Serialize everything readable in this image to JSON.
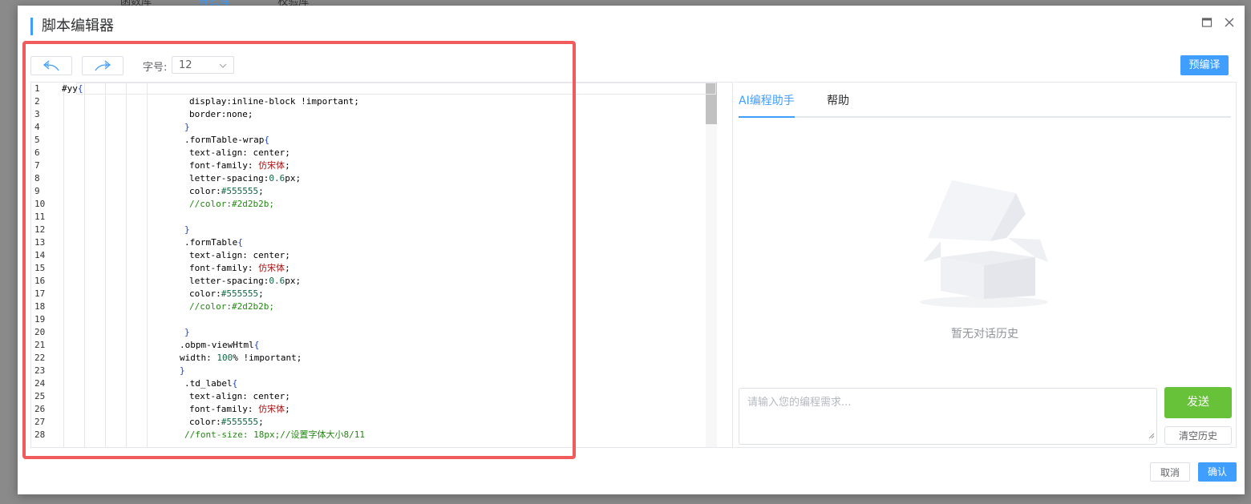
{
  "background_tabs": [
    "函数库",
    "样式库",
    "校验库"
  ],
  "modal": {
    "title": "脚本编辑器",
    "maximize_icon": "maximize-icon",
    "close_icon": "close-icon"
  },
  "toolbar": {
    "undo_icon": "undo-icon",
    "redo_icon": "redo-icon",
    "font_size_label": "字号:",
    "font_size_value": "12",
    "precompile_label": "预编译"
  },
  "editor": {
    "lines": [
      {
        "n": "1",
        "indent": 0,
        "tokens": [
          [
            "t",
            "#yy"
          ],
          [
            "b",
            "{"
          ]
        ]
      },
      {
        "n": "2",
        "indent": 159,
        "tokens": [
          [
            "t",
            "display:inline-block !important;"
          ]
        ]
      },
      {
        "n": "3",
        "indent": 159,
        "tokens": [
          [
            "t",
            "border:none;"
          ]
        ]
      },
      {
        "n": "4",
        "indent": 153,
        "tokens": [
          [
            "b",
            "}"
          ]
        ]
      },
      {
        "n": "5",
        "indent": 153,
        "tokens": [
          [
            "t",
            ".formTable-wrap"
          ],
          [
            "b",
            "{"
          ]
        ]
      },
      {
        "n": "6",
        "indent": 159,
        "tokens": [
          [
            "t",
            "text-align: center;"
          ]
        ]
      },
      {
        "n": "7",
        "indent": 159,
        "tokens": [
          [
            "t",
            "font-family: "
          ],
          [
            "s",
            "仿宋体"
          ],
          [
            "t",
            ";"
          ]
        ]
      },
      {
        "n": "8",
        "indent": 159,
        "tokens": [
          [
            "t",
            "letter-spacing:"
          ],
          [
            "n",
            "0.6"
          ],
          [
            "t",
            "px;"
          ]
        ]
      },
      {
        "n": "9",
        "indent": 159,
        "tokens": [
          [
            "t",
            "color:"
          ],
          [
            "h",
            "#555555"
          ],
          [
            "t",
            ";"
          ]
        ]
      },
      {
        "n": "10",
        "indent": 159,
        "tokens": [
          [
            "c",
            "//color:#2d2b2b;"
          ]
        ]
      },
      {
        "n": "11",
        "indent": 0,
        "tokens": []
      },
      {
        "n": "12",
        "indent": 153,
        "tokens": [
          [
            "b",
            "}"
          ]
        ]
      },
      {
        "n": "13",
        "indent": 153,
        "tokens": [
          [
            "t",
            ".formTable"
          ],
          [
            "b",
            "{"
          ]
        ]
      },
      {
        "n": "14",
        "indent": 159,
        "tokens": [
          [
            "t",
            "text-align: center;"
          ]
        ]
      },
      {
        "n": "15",
        "indent": 159,
        "tokens": [
          [
            "t",
            "font-family: "
          ],
          [
            "s",
            "仿宋体"
          ],
          [
            "t",
            ";"
          ]
        ]
      },
      {
        "n": "16",
        "indent": 159,
        "tokens": [
          [
            "t",
            "letter-spacing:"
          ],
          [
            "n",
            "0.6"
          ],
          [
            "t",
            "px;"
          ]
        ]
      },
      {
        "n": "17",
        "indent": 159,
        "tokens": [
          [
            "t",
            "color:"
          ],
          [
            "h",
            "#555555"
          ],
          [
            "t",
            ";"
          ]
        ]
      },
      {
        "n": "18",
        "indent": 159,
        "tokens": [
          [
            "c",
            "//color:#2d2b2b;"
          ]
        ]
      },
      {
        "n": "19",
        "indent": 0,
        "tokens": []
      },
      {
        "n": "20",
        "indent": 153,
        "tokens": [
          [
            "b",
            "}"
          ]
        ]
      },
      {
        "n": "21",
        "indent": 147,
        "tokens": [
          [
            "t",
            ".obpm-viewHtml"
          ],
          [
            "b",
            "{"
          ]
        ]
      },
      {
        "n": "22",
        "indent": 147,
        "tokens": [
          [
            "t",
            "width: "
          ],
          [
            "n",
            "100"
          ],
          [
            "t",
            "% !important;"
          ]
        ]
      },
      {
        "n": "23",
        "indent": 147,
        "tokens": [
          [
            "b",
            "}"
          ]
        ]
      },
      {
        "n": "24",
        "indent": 153,
        "tokens": [
          [
            "t",
            ".td_label"
          ],
          [
            "b",
            "{"
          ]
        ]
      },
      {
        "n": "25",
        "indent": 159,
        "tokens": [
          [
            "t",
            "text-align: center;"
          ]
        ]
      },
      {
        "n": "26",
        "indent": 159,
        "tokens": [
          [
            "t",
            "font-family: "
          ],
          [
            "s",
            "仿宋体"
          ],
          [
            "t",
            ";"
          ]
        ]
      },
      {
        "n": "27",
        "indent": 159,
        "tokens": [
          [
            "t",
            "color:"
          ],
          [
            "h",
            "#555555"
          ],
          [
            "t",
            ";"
          ]
        ]
      },
      {
        "n": "28",
        "indent": 153,
        "tokens": [
          [
            "c",
            "//font-size: 18px;//设置字体大小8/11"
          ]
        ]
      }
    ]
  },
  "assistant": {
    "tabs": [
      {
        "label": "AI编程助手",
        "active": true
      },
      {
        "label": "帮助",
        "active": false
      }
    ],
    "empty_icon": "empty-box-icon",
    "empty_text": "暂无对话历史",
    "input_placeholder": "请输入您的编程需求...",
    "send_label": "发送",
    "clear_label": "清空历史"
  },
  "footer": {
    "cancel_label": "取消",
    "confirm_label": "确认"
  },
  "colors": {
    "primary": "#409eff",
    "success": "#67c23a",
    "highlight": "#f25b5b"
  }
}
